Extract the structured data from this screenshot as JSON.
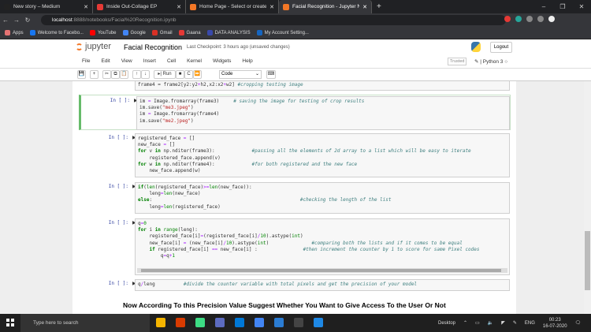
{
  "browser": {
    "tabs": [
      {
        "title": "New story – Medium",
        "color": "#222",
        "active": false
      },
      {
        "title": "Inside Out-Collage EP",
        "color": "#e53935",
        "active": false
      },
      {
        "title": "Home Page - Select or create a n",
        "color": "#f37726",
        "active": false
      },
      {
        "title": "Facial Recognition - Jupyter Note",
        "color": "#f37726",
        "active": true
      }
    ],
    "new_tab": "+",
    "url_host": "localhost",
    "url_path": ":8888/notebooks/Facial%20Recognition.ipynb",
    "bookmarks": [
      {
        "label": "Apps",
        "color": "#e57373"
      },
      {
        "label": "Welcome to Facebo...",
        "color": "#1877f2"
      },
      {
        "label": "YouTube",
        "color": "#ff0000"
      },
      {
        "label": "Google",
        "color": "#4285f4"
      },
      {
        "label": "Gmail",
        "color": "#d93025"
      },
      {
        "label": "Gaana",
        "color": "#e53935"
      },
      {
        "label": "DATA ANALYSIS",
        "color": "#3949ab"
      },
      {
        "label": "My Account Setting...",
        "color": "#1565c0"
      }
    ]
  },
  "jupyter": {
    "logo": "jupyter",
    "title": "Facial Recognition",
    "checkpoint": "Last Checkpoint: 3 hours ago  (unsaved changes)",
    "logout": "Logout",
    "menu": [
      "File",
      "Edit",
      "View",
      "Insert",
      "Cell",
      "Kernel",
      "Widgets",
      "Help"
    ],
    "trusted": "Trusted",
    "kernel": "Python 3",
    "toolbar": {
      "run": "Run",
      "cell_type": "Code"
    }
  },
  "cells": [
    {
      "prompt": "",
      "lines": [
        [
          [
            "frame4 ",
            ""
          ],
          [
            "=",
            ""
          ],
          [
            " frame2[y2:y2",
            ""
          ],
          [
            "+",
            "op"
          ],
          [
            "h2,x2:x2",
            ""
          ],
          [
            "+",
            "op"
          ],
          [
            "w2] ",
            ""
          ],
          [
            "#cropping testing image",
            "cm"
          ]
        ]
      ]
    },
    {
      "prompt": "In [ ]:",
      "lines": [
        [
          [
            "im ",
            ""
          ],
          [
            "=",
            "op"
          ],
          [
            " Image.fromarray(frame3)     ",
            ""
          ],
          [
            "# saving the image for testing of crop results",
            "cm"
          ]
        ],
        [
          [
            "im.save(",
            ""
          ],
          [
            "\"me3.jpeg\"",
            "st"
          ],
          [
            ")",
            ""
          ]
        ],
        [
          [
            "im ",
            ""
          ],
          [
            "=",
            "op"
          ],
          [
            " Image.fromarray(frame4)",
            ""
          ]
        ],
        [
          [
            "im.save(",
            ""
          ],
          [
            "\"me2.jpeg\"",
            "st"
          ],
          [
            ")",
            ""
          ]
        ]
      ]
    },
    {
      "prompt": "In [ ]:",
      "lines": [
        [
          [
            "registered_face ",
            ""
          ],
          [
            "=",
            "op"
          ],
          [
            " []",
            ""
          ]
        ],
        [
          [
            "new_face ",
            ""
          ],
          [
            "=",
            "op"
          ],
          [
            " []",
            ""
          ]
        ],
        [
          [
            "for",
            "kw"
          ],
          [
            " v ",
            ""
          ],
          [
            "in",
            "kw"
          ],
          [
            " np.nditer(frame3):             ",
            ""
          ],
          [
            "#passing all the elements of 2d array to a list which will be easy to iterate",
            "cm"
          ]
        ],
        [
          [
            "    registered_face.append(v)",
            ""
          ]
        ],
        [
          [
            "for",
            "kw"
          ],
          [
            " w ",
            ""
          ],
          [
            "in",
            "kw"
          ],
          [
            " np.nditer(frame4):             ",
            ""
          ],
          [
            "#for both registered and the new face",
            "cm"
          ]
        ],
        [
          [
            "    new_face.append(w)",
            ""
          ]
        ]
      ]
    },
    {
      "prompt": "In [ ]:",
      "lines": [
        [
          [
            "if",
            "kw"
          ],
          [
            "(",
            ""
          ],
          [
            "len",
            "bi"
          ],
          [
            "(registered_face)",
            ""
          ],
          [
            ">=",
            "op"
          ],
          [
            "len",
            "bi"
          ],
          [
            "(new_face)):",
            ""
          ]
        ],
        [
          [
            "    leng",
            ""
          ],
          [
            "=",
            "op"
          ],
          [
            "len",
            "bi"
          ],
          [
            "(new_face)",
            ""
          ]
        ],
        [
          [
            "else",
            "kw"
          ],
          [
            ":                                                    ",
            ""
          ],
          [
            "#checking the length of the list",
            "cm"
          ]
        ],
        [
          [
            "    leng",
            ""
          ],
          [
            "=",
            "op"
          ],
          [
            "len",
            "bi"
          ],
          [
            "(registered_face)",
            ""
          ]
        ]
      ]
    },
    {
      "prompt": "In [ ]:",
      "lines": [
        [
          [
            "q",
            ""
          ],
          [
            "=",
            "op"
          ],
          [
            "0",
            "nm"
          ]
        ],
        [
          [
            "for",
            "kw"
          ],
          [
            " i ",
            ""
          ],
          [
            "in",
            "kw"
          ],
          [
            " ",
            ""
          ],
          [
            "range",
            "bi"
          ],
          [
            "(leng):",
            ""
          ]
        ],
        [
          [
            "    registered_face[i]",
            ""
          ],
          [
            "=",
            "op"
          ],
          [
            "(registered_face[i]",
            ""
          ],
          [
            "/",
            "op"
          ],
          [
            "10",
            "nm"
          ],
          [
            ").astype(",
            ""
          ],
          [
            "int",
            "bi"
          ],
          [
            ")",
            ""
          ]
        ],
        [
          [
            "    new_face[i] ",
            ""
          ],
          [
            "=",
            "op"
          ],
          [
            " (new_face[i]",
            ""
          ],
          [
            "/",
            "op"
          ],
          [
            "10",
            "nm"
          ],
          [
            ").astype(",
            ""
          ],
          [
            "int",
            "bi"
          ],
          [
            ")               ",
            ""
          ],
          [
            "#comparing both the lists and if it comes to be equal",
            "cm"
          ]
        ],
        [
          [
            "    ",
            ""
          ],
          [
            "if",
            "kw"
          ],
          [
            " registered_face[i] ",
            ""
          ],
          [
            "==",
            "op"
          ],
          [
            " new_face[i] :                ",
            ""
          ],
          [
            "#then increment the counter by 1 to score for same Pixel codes",
            "cm"
          ]
        ],
        [
          [
            "        q",
            ""
          ],
          [
            "=",
            "op"
          ],
          [
            "q",
            ""
          ],
          [
            "+",
            "op"
          ],
          [
            "1",
            "nm"
          ]
        ]
      ]
    },
    {
      "prompt": "In [ ]:",
      "lines": [
        [
          [
            "q",
            ""
          ],
          [
            "/",
            "op"
          ],
          [
            "leng          ",
            ""
          ],
          [
            "#divide the counter variable with total pixels and get the precision of your model",
            "cm"
          ]
        ]
      ]
    }
  ],
  "markdown_heading": "Now According To this Precision Value Suggest Whether You Want to Give Access To the User Or Not",
  "taskbar": {
    "search_placeholder": "Type here to search",
    "desktop": "Desktop",
    "lang": "ENG",
    "time": "00:23",
    "date": "16-07-2020",
    "apps": [
      "#f4b400",
      "#d83b01",
      "#3ddc84",
      "#5c6bc0",
      "#0078d7",
      "#4285f4",
      "#2b7cd3",
      "#444",
      "#1e88e5"
    ]
  }
}
